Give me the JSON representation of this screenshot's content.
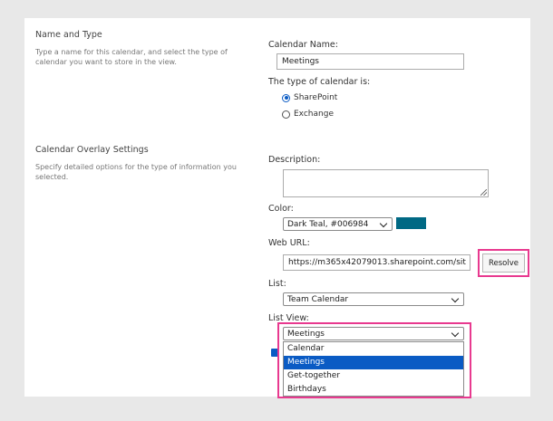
{
  "section_name_type": {
    "title": "Name and Type",
    "description": "Type a name for this calendar, and select the type of calendar you want to store in the view."
  },
  "calendar_name": {
    "label": "Calendar Name:",
    "value": "Meetings"
  },
  "calendar_type": {
    "label": "The type of calendar is:",
    "options": [
      {
        "label": "SharePoint",
        "checked": true
      },
      {
        "label": "Exchange",
        "checked": false
      }
    ]
  },
  "section_overlay": {
    "title": "Calendar Overlay Settings",
    "description": "Specify detailed options for the type of information you selected."
  },
  "description_field": {
    "label": "Description:",
    "value": ""
  },
  "color_field": {
    "label": "Color:",
    "selected": "Dark Teal, #006984",
    "swatch_color": "#006984"
  },
  "web_url": {
    "label": "Web URL:",
    "value": "https://m365x42079013.sharepoint.com/sit",
    "resolve_label": "Resolve"
  },
  "list_field": {
    "label": "List:",
    "selected": "Team Calendar"
  },
  "list_view": {
    "label": "List View:",
    "selected": "Meetings",
    "options": [
      "Calendar",
      "Meetings",
      "Get-together",
      "Birthdays"
    ],
    "highlighted_index": 1
  },
  "colors": {
    "highlight_border": "#e8398f",
    "selection_blue": "#0a5bc4"
  }
}
